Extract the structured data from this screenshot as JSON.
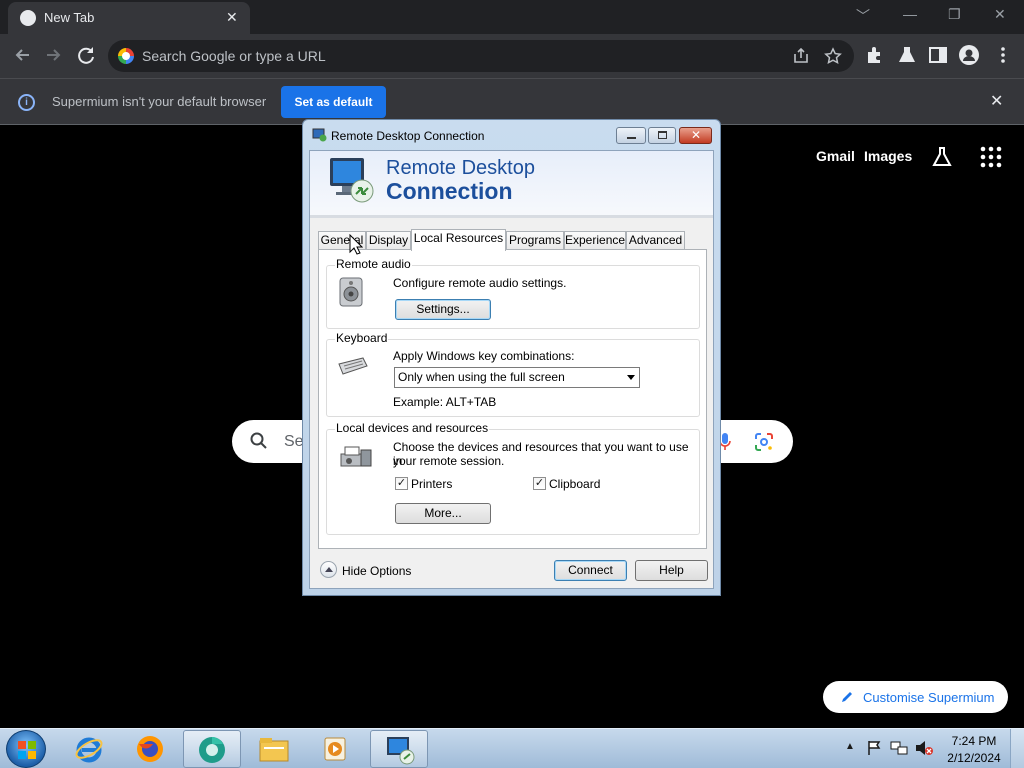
{
  "browser": {
    "tab_title": "New Tab",
    "omnibox_placeholder": "Search Google or type a URL",
    "infobar_text": "Supermium isn't your default browser",
    "set_default_label": "Set as default",
    "ntp_links": {
      "gmail": "Gmail",
      "images": "Images"
    },
    "ntp_search_text": "Se",
    "customise_label": "Customise Supermium",
    "accent_color": "#1a73e8"
  },
  "rdc": {
    "window_title": "Remote Desktop Connection",
    "banner_line1": "Remote Desktop",
    "banner_line2": "Connection",
    "tabs": [
      {
        "label": "General",
        "active": false
      },
      {
        "label": "Display",
        "active": false
      },
      {
        "label": "Local Resources",
        "active": true
      },
      {
        "label": "Programs",
        "active": false
      },
      {
        "label": "Experience",
        "active": false
      },
      {
        "label": "Advanced",
        "active": false
      }
    ],
    "remote_audio": {
      "group_label": "Remote audio",
      "description": "Configure remote audio settings.",
      "button": "Settings..."
    },
    "keyboard": {
      "group_label": "Keyboard",
      "description": "Apply Windows key combinations:",
      "selected_option": "Only when using the full screen",
      "example": "Example: ALT+TAB"
    },
    "local_devices": {
      "group_label": "Local devices and resources",
      "description_line1": "Choose the devices and resources that you want to use in",
      "description_line2": "your remote session.",
      "printers_label": "Printers",
      "printers_checked": true,
      "clipboard_label": "Clipboard",
      "clipboard_checked": true,
      "more_button": "More..."
    },
    "hide_options": "Hide Options",
    "connect_button": "Connect",
    "help_button": "Help"
  },
  "taskbar": {
    "time": "7:24 PM",
    "date": "2/12/2024",
    "apps": [
      "internet-explorer-icon",
      "firefox-icon",
      "supermium-icon",
      "file-explorer-icon",
      "media-player-icon",
      "remote-desktop-icon"
    ]
  }
}
